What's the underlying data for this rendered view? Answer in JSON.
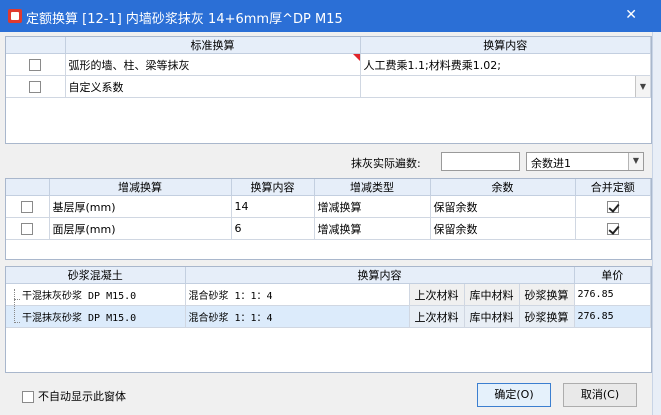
{
  "window": {
    "title": "定额换算 [12-1] 内墙砂浆抹灰 14+6mm厚^DP M15",
    "close_glyph": "✕"
  },
  "std_table": {
    "headers": [
      "标准换算",
      "换算内容"
    ],
    "rows": [
      {
        "name": "弧形的墙、柱、梁等抹灰",
        "content": "人工费乘1.1;材料费乘1.02;",
        "checked": false
      },
      {
        "name": "自定义系数",
        "content": "",
        "checked": false
      }
    ]
  },
  "plaster": {
    "label": "抹灰实际遍数:",
    "value": "",
    "rounding": "余数进1"
  },
  "inc_table": {
    "headers": [
      "增减换算",
      "换算内容",
      "增减类型",
      "余数",
      "合并定额"
    ],
    "rows": [
      {
        "name": "基层厚(mm)",
        "value": "14",
        "type": "增减换算",
        "remainder": "保留余数",
        "merge": true
      },
      {
        "name": "面层厚(mm)",
        "value": "6",
        "type": "增减换算",
        "remainder": "保留余数",
        "merge": true
      }
    ]
  },
  "mortar_table": {
    "headers": [
      "砂浆混凝土",
      "换算内容",
      "单价"
    ],
    "rows": [
      {
        "name": "干混抹灰砂浆 DP M15.0",
        "content": "混合砂浆 1：1：4",
        "btn1": "上次材料",
        "btn2": "库中材料",
        "btn3": "砂浆换算",
        "price": "276.85"
      },
      {
        "name": "干混抹灰砂浆 DP M15.0",
        "content": "混合砂浆 1：1：4",
        "btn1": "上次材料",
        "btn2": "库中材料",
        "btn3": "砂浆换算",
        "price": "276.85"
      }
    ]
  },
  "footer": {
    "no_auto_label": "不自动显示此窗体",
    "ok_label": "确定(O)",
    "cancel_label": "取消(C)"
  }
}
